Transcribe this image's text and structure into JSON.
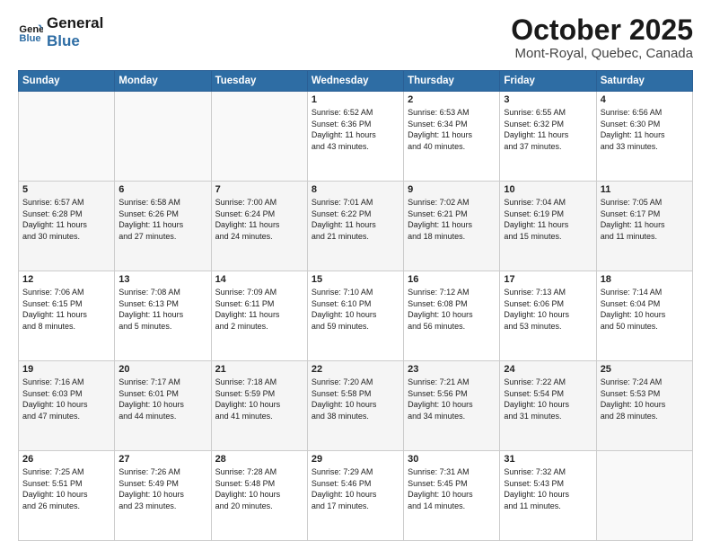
{
  "header": {
    "logo_line1": "General",
    "logo_line2": "Blue",
    "title": "October 2025",
    "subtitle": "Mont-Royal, Quebec, Canada"
  },
  "calendar": {
    "days_of_week": [
      "Sunday",
      "Monday",
      "Tuesday",
      "Wednesday",
      "Thursday",
      "Friday",
      "Saturday"
    ],
    "weeks": [
      [
        {
          "num": "",
          "info": ""
        },
        {
          "num": "",
          "info": ""
        },
        {
          "num": "",
          "info": ""
        },
        {
          "num": "1",
          "info": "Sunrise: 6:52 AM\nSunset: 6:36 PM\nDaylight: 11 hours\nand 43 minutes."
        },
        {
          "num": "2",
          "info": "Sunrise: 6:53 AM\nSunset: 6:34 PM\nDaylight: 11 hours\nand 40 minutes."
        },
        {
          "num": "3",
          "info": "Sunrise: 6:55 AM\nSunset: 6:32 PM\nDaylight: 11 hours\nand 37 minutes."
        },
        {
          "num": "4",
          "info": "Sunrise: 6:56 AM\nSunset: 6:30 PM\nDaylight: 11 hours\nand 33 minutes."
        }
      ],
      [
        {
          "num": "5",
          "info": "Sunrise: 6:57 AM\nSunset: 6:28 PM\nDaylight: 11 hours\nand 30 minutes."
        },
        {
          "num": "6",
          "info": "Sunrise: 6:58 AM\nSunset: 6:26 PM\nDaylight: 11 hours\nand 27 minutes."
        },
        {
          "num": "7",
          "info": "Sunrise: 7:00 AM\nSunset: 6:24 PM\nDaylight: 11 hours\nand 24 minutes."
        },
        {
          "num": "8",
          "info": "Sunrise: 7:01 AM\nSunset: 6:22 PM\nDaylight: 11 hours\nand 21 minutes."
        },
        {
          "num": "9",
          "info": "Sunrise: 7:02 AM\nSunset: 6:21 PM\nDaylight: 11 hours\nand 18 minutes."
        },
        {
          "num": "10",
          "info": "Sunrise: 7:04 AM\nSunset: 6:19 PM\nDaylight: 11 hours\nand 15 minutes."
        },
        {
          "num": "11",
          "info": "Sunrise: 7:05 AM\nSunset: 6:17 PM\nDaylight: 11 hours\nand 11 minutes."
        }
      ],
      [
        {
          "num": "12",
          "info": "Sunrise: 7:06 AM\nSunset: 6:15 PM\nDaylight: 11 hours\nand 8 minutes."
        },
        {
          "num": "13",
          "info": "Sunrise: 7:08 AM\nSunset: 6:13 PM\nDaylight: 11 hours\nand 5 minutes."
        },
        {
          "num": "14",
          "info": "Sunrise: 7:09 AM\nSunset: 6:11 PM\nDaylight: 11 hours\nand 2 minutes."
        },
        {
          "num": "15",
          "info": "Sunrise: 7:10 AM\nSunset: 6:10 PM\nDaylight: 10 hours\nand 59 minutes."
        },
        {
          "num": "16",
          "info": "Sunrise: 7:12 AM\nSunset: 6:08 PM\nDaylight: 10 hours\nand 56 minutes."
        },
        {
          "num": "17",
          "info": "Sunrise: 7:13 AM\nSunset: 6:06 PM\nDaylight: 10 hours\nand 53 minutes."
        },
        {
          "num": "18",
          "info": "Sunrise: 7:14 AM\nSunset: 6:04 PM\nDaylight: 10 hours\nand 50 minutes."
        }
      ],
      [
        {
          "num": "19",
          "info": "Sunrise: 7:16 AM\nSunset: 6:03 PM\nDaylight: 10 hours\nand 47 minutes."
        },
        {
          "num": "20",
          "info": "Sunrise: 7:17 AM\nSunset: 6:01 PM\nDaylight: 10 hours\nand 44 minutes."
        },
        {
          "num": "21",
          "info": "Sunrise: 7:18 AM\nSunset: 5:59 PM\nDaylight: 10 hours\nand 41 minutes."
        },
        {
          "num": "22",
          "info": "Sunrise: 7:20 AM\nSunset: 5:58 PM\nDaylight: 10 hours\nand 38 minutes."
        },
        {
          "num": "23",
          "info": "Sunrise: 7:21 AM\nSunset: 5:56 PM\nDaylight: 10 hours\nand 34 minutes."
        },
        {
          "num": "24",
          "info": "Sunrise: 7:22 AM\nSunset: 5:54 PM\nDaylight: 10 hours\nand 31 minutes."
        },
        {
          "num": "25",
          "info": "Sunrise: 7:24 AM\nSunset: 5:53 PM\nDaylight: 10 hours\nand 28 minutes."
        }
      ],
      [
        {
          "num": "26",
          "info": "Sunrise: 7:25 AM\nSunset: 5:51 PM\nDaylight: 10 hours\nand 26 minutes."
        },
        {
          "num": "27",
          "info": "Sunrise: 7:26 AM\nSunset: 5:49 PM\nDaylight: 10 hours\nand 23 minutes."
        },
        {
          "num": "28",
          "info": "Sunrise: 7:28 AM\nSunset: 5:48 PM\nDaylight: 10 hours\nand 20 minutes."
        },
        {
          "num": "29",
          "info": "Sunrise: 7:29 AM\nSunset: 5:46 PM\nDaylight: 10 hours\nand 17 minutes."
        },
        {
          "num": "30",
          "info": "Sunrise: 7:31 AM\nSunset: 5:45 PM\nDaylight: 10 hours\nand 14 minutes."
        },
        {
          "num": "31",
          "info": "Sunrise: 7:32 AM\nSunset: 5:43 PM\nDaylight: 10 hours\nand 11 minutes."
        },
        {
          "num": "",
          "info": ""
        }
      ]
    ]
  }
}
